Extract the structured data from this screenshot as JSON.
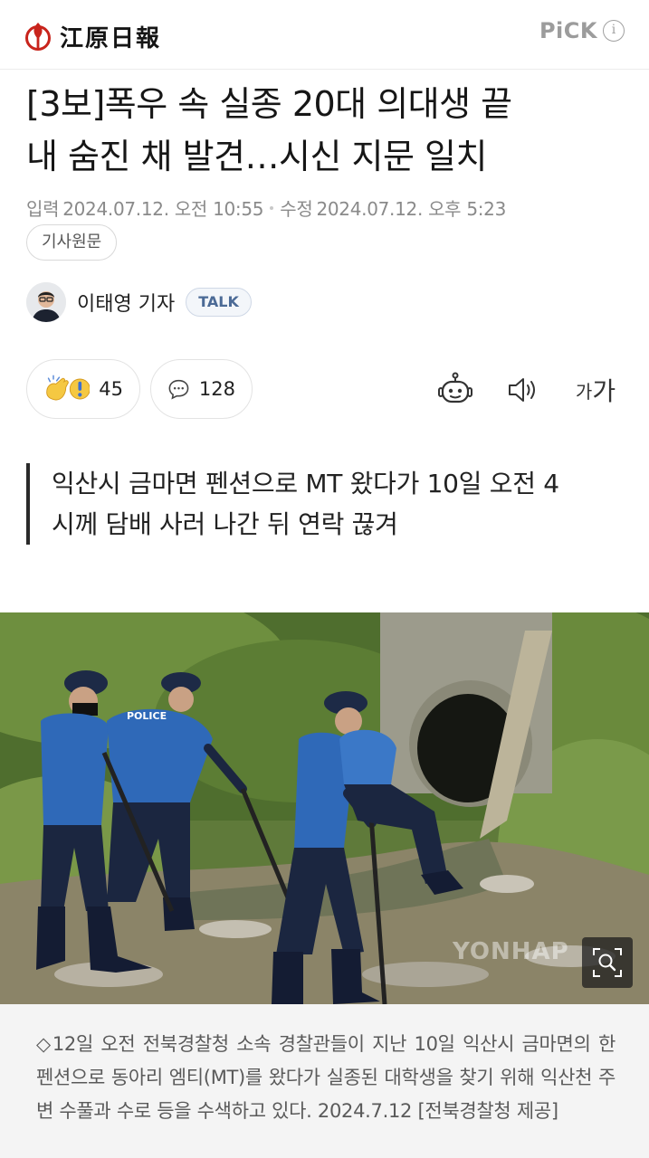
{
  "header": {
    "logo_text": "江原日報",
    "pick_label": "PiCK",
    "info_symbol": "i"
  },
  "article": {
    "headline_line1": "[3보]폭우 속 실종 20대 의대생 끝",
    "headline_line2": "내 숨진 채 발견…시신 지문 일치",
    "input_label": "입력",
    "input_datetime": "2024.07.12. 오전 10:55",
    "modified_label": "수정",
    "modified_datetime": "2024.07.12. 오후 5:23",
    "original_button": "기사원문",
    "reporter_name": "이태영 기자",
    "talk_badge": "TALK",
    "reaction_count": "45",
    "comment_count": "128",
    "font_small": "가",
    "font_big": "가",
    "subhead_line1": "익산시 금마면 펜션으로 MT 왔다가 10일 오전 4",
    "subhead_line2": "시께 담배 사러 나간 뒤 연락 끊겨",
    "photo_watermark": "YONHAP",
    "caption_text": "◇12일 오전 전북경찰청 소속 경찰관들이 지난 10일 익산시 금마면의 한 펜션으로 동아리 엠티(MT)를 왔다가 실종된 대학생을 찾기 위해 익산천 주변 수풀과 수로 등을 수색하고 있다. 2024.7.12 [전북경찰청 제공]",
    "police_text": "POLICE"
  },
  "colors": {
    "logo_red": "#c8241c",
    "talk_blue": "#4b6a96",
    "meta_gray": "#8a8a8a"
  },
  "icons": {
    "reaction": "clap-exclaim-emoji-icon",
    "comment": "speech-bubble-icon",
    "robot": "robot-summary-icon",
    "speaker": "speaker-tts-icon",
    "zoom": "image-zoom-icon"
  }
}
